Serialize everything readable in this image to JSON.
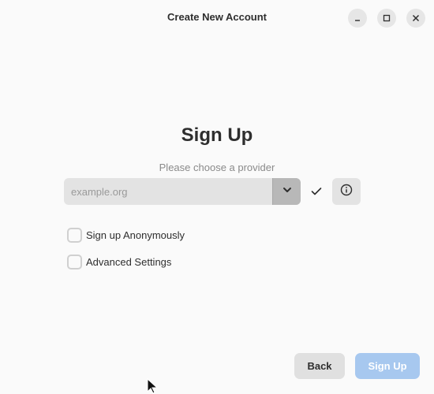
{
  "window": {
    "title": "Create New Account"
  },
  "form": {
    "heading": "Sign Up",
    "subtitle": "Please choose a provider",
    "provider_placeholder": "example.org",
    "provider_value": "",
    "checkboxes": [
      {
        "label": "Sign up Anonymously",
        "checked": false
      },
      {
        "label": "Advanced Settings",
        "checked": false
      }
    ]
  },
  "buttons": {
    "back_label": "Back",
    "signup_label": "Sign Up"
  },
  "icons": {
    "minimize": "minimize-icon",
    "maximize": "maximize-icon",
    "close": "close-icon",
    "dropdown": "chevron-down-icon",
    "valid": "checkmark-icon",
    "info": "info-icon"
  },
  "colors": {
    "background": "#fafafa",
    "primary_disabled": "#a7c8ef",
    "text": "#2e2e2e"
  }
}
